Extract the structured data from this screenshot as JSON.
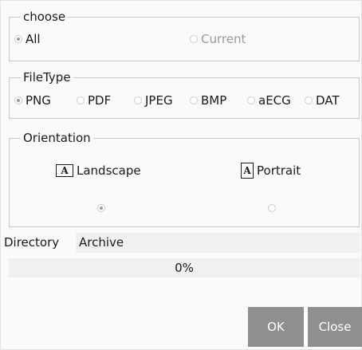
{
  "choose": {
    "legend": "choose",
    "options": [
      {
        "label": "All",
        "checked": true,
        "enabled": true
      },
      {
        "label": "Current",
        "checked": false,
        "enabled": false
      }
    ]
  },
  "filetype": {
    "legend": "FileType",
    "options": [
      {
        "label": "PNG",
        "checked": true
      },
      {
        "label": "PDF",
        "checked": false
      },
      {
        "label": "JPEG",
        "checked": false
      },
      {
        "label": "BMP",
        "checked": false
      },
      {
        "label": "aECG",
        "checked": false
      },
      {
        "label": "DAT",
        "checked": false
      }
    ]
  },
  "orientation": {
    "legend": "Orientation",
    "landscape": {
      "label": "Landscape",
      "icon": "A",
      "checked": true
    },
    "portrait": {
      "label": "Portrait",
      "icon": "A",
      "checked": false
    }
  },
  "directory": {
    "label": "Directory",
    "value": "Archive"
  },
  "progress": {
    "value": 0,
    "text": "0%"
  },
  "buttons": {
    "ok": "OK",
    "close": "Close"
  }
}
